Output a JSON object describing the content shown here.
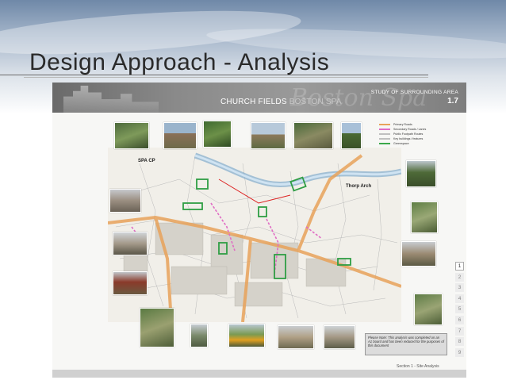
{
  "slide": {
    "title": "Design Approach - Analysis"
  },
  "poster": {
    "banner_title_main": "CHURCH FIELDS",
    "banner_title_sub": "BOSTON SPA",
    "banner_script": "Boston Spa",
    "study_label": "STUDY OF SURROUNDING AREA",
    "study_number": "1.7",
    "legend": [
      {
        "label": "Primary Roads",
        "color": "#e8a25a"
      },
      {
        "label": "Secondary Roads / Lanes",
        "color": "#e06cc4"
      },
      {
        "label": "Public Footpath Routes",
        "color": "#c0c0c0"
      },
      {
        "label": "Key buildings / features",
        "color": "#c0c0c0"
      },
      {
        "label": "Greenspace",
        "color": "#3aa84a"
      }
    ],
    "place_labels": {
      "spa_cp": "SPA CP",
      "thorp_arch": "Thorp Arch"
    },
    "note": "Please Note: This analysis was completed on an A1 board and has been reduced for the purposes of this document",
    "section_label": "Section 1 - Site Analysis",
    "tabs": [
      "1",
      "2",
      "3",
      "4",
      "5",
      "6",
      "7",
      "8",
      "9"
    ],
    "active_tab": "1"
  }
}
